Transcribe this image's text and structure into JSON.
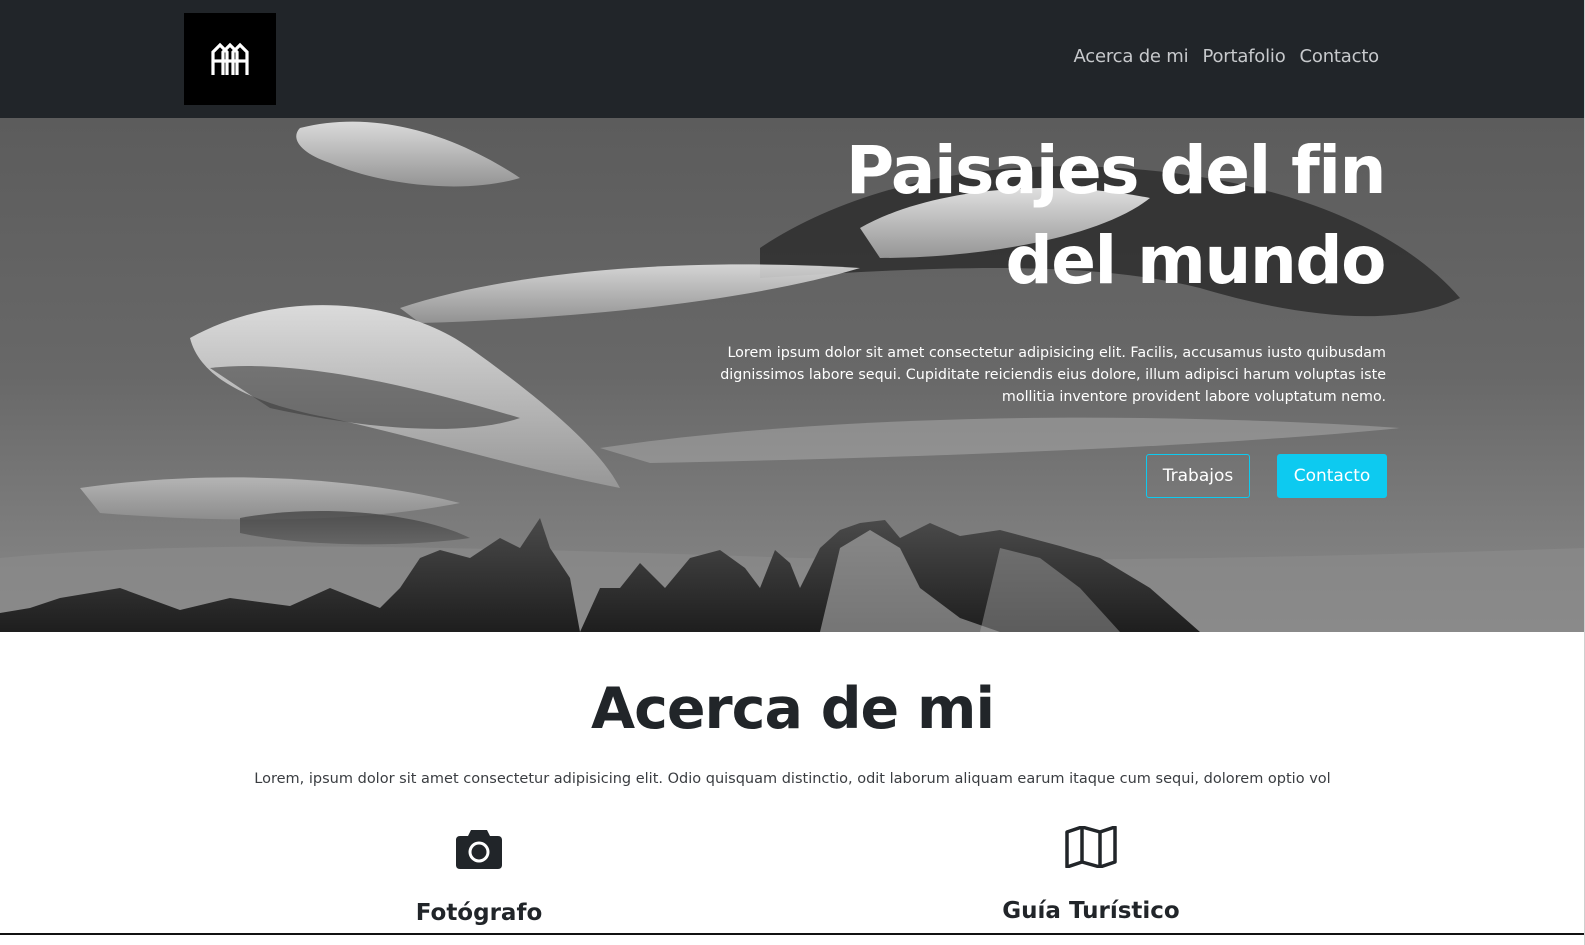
{
  "navbar": {
    "logo_text": "AAA",
    "links": [
      {
        "label": "Acerca de mi"
      },
      {
        "label": "Portafolio"
      },
      {
        "label": "Contacto"
      }
    ]
  },
  "hero": {
    "title_line1": "Paisajes del fin",
    "title_line2": "del mundo",
    "text": "Lorem ipsum dolor sit amet consectetur adipisicing elit. Facilis, accusamus iusto quibusdam dignissimos labore sequi. Cupiditate reiciendis eius dolore, illum adipisci harum voluptas iste mollitia inventore provident labore voluptatum nemo.",
    "buttons": {
      "outline_label": "Trabajos",
      "solid_label": "Contacto"
    }
  },
  "about": {
    "title": "Acerca de mi",
    "text": "Lorem, ipsum dolor sit amet consectetur adipisicing elit. Odio quisquam distinctio, odit laborum aliquam earum itaque cum sequi, dolorem optio vol",
    "features": [
      {
        "icon": "camera-icon",
        "title": "Fotógrafo"
      },
      {
        "icon": "map-icon",
        "title": "Guía Turístico"
      }
    ]
  },
  "colors": {
    "navbar_bg": "#212529",
    "accent": "#0dcaf0",
    "text_dark": "#212529"
  }
}
